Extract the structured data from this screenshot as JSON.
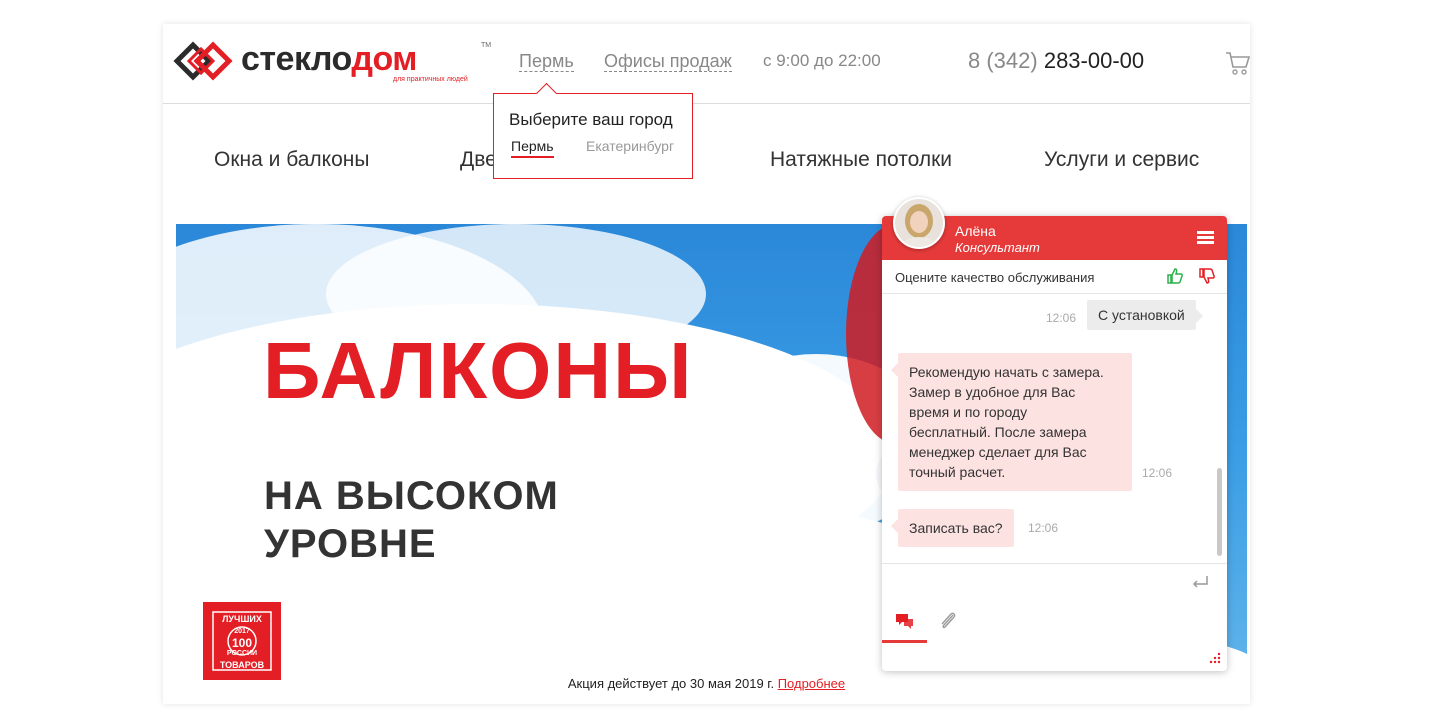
{
  "header": {
    "logo_text_a": "стекло",
    "logo_text_b": "дом",
    "logo_tm": "TM",
    "logo_slogan": "для практичных людей",
    "city": "Пермь",
    "offices": "Офисы продаж",
    "hours": "с 9:00 до 22:00",
    "phone_prefix": "8 (342) ",
    "phone_number": "283-00-00"
  },
  "city_popup": {
    "title": "Выберите ваш город",
    "cities": [
      "Пермь",
      "Екатеринбург"
    ]
  },
  "nav": {
    "items": [
      "Окна и балконы",
      "Две",
      "Натяжные потолки",
      "Услуги и сервис"
    ]
  },
  "banner": {
    "title": "БАЛКОНЫ",
    "subtitle_line1": "НА ВЫСОКОМ",
    "subtitle_line2": "УРОВНЕ",
    "award_top": "ЛУЧШИХ",
    "award_year": "2017",
    "award_mid": "100",
    "award_mid2": "РОССИИ",
    "award_bottom": "ТОВАРОВ"
  },
  "promo": {
    "text": "Акция действует до 30 мая 2019 г. ",
    "link": "Подробнее"
  },
  "chat": {
    "agent_name": "Алёна",
    "agent_role": "Консультант",
    "rate_text": "Оцените качество обслуживания",
    "messages": [
      {
        "from": "user",
        "time": "12:06",
        "text": "С установкой"
      },
      {
        "from": "agent",
        "time": "12:06",
        "lines": [
          "Рекомендую начать с замера.",
          "Замер в удобное для Вас",
          "время и по городу",
          "бесплатный. После замера",
          "менеджер  сделает для Вас",
          "точный расчет."
        ]
      },
      {
        "from": "agent",
        "time": "12:06",
        "text": "Записать вас?"
      }
    ]
  },
  "colors": {
    "brand_red": "#e31e24",
    "chat_red": "#e63a3a",
    "agent_bubble": "#fde2e2",
    "user_bubble": "#ececec"
  }
}
